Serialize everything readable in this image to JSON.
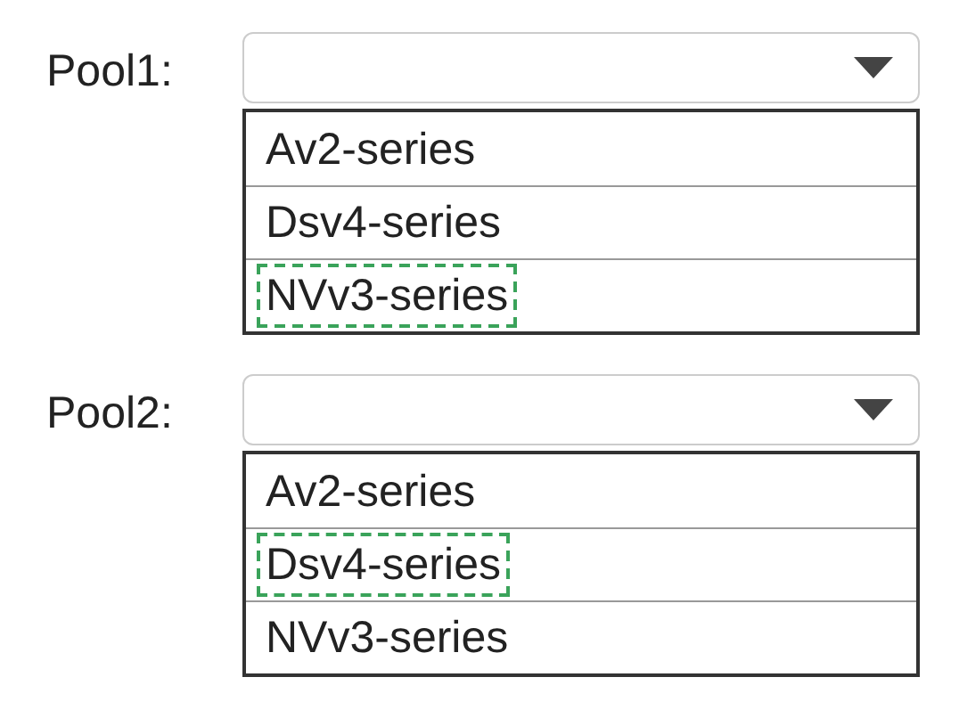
{
  "pools": [
    {
      "label": "Pool1:",
      "options": [
        {
          "text": "Av2-series",
          "selected": false
        },
        {
          "text": "Dsv4-series",
          "selected": false
        },
        {
          "text": "NVv3-series",
          "selected": true
        }
      ]
    },
    {
      "label": "Pool2:",
      "options": [
        {
          "text": "Av2-series",
          "selected": false
        },
        {
          "text": "Dsv4-series",
          "selected": true
        },
        {
          "text": "NVv3-series",
          "selected": false
        }
      ]
    }
  ]
}
